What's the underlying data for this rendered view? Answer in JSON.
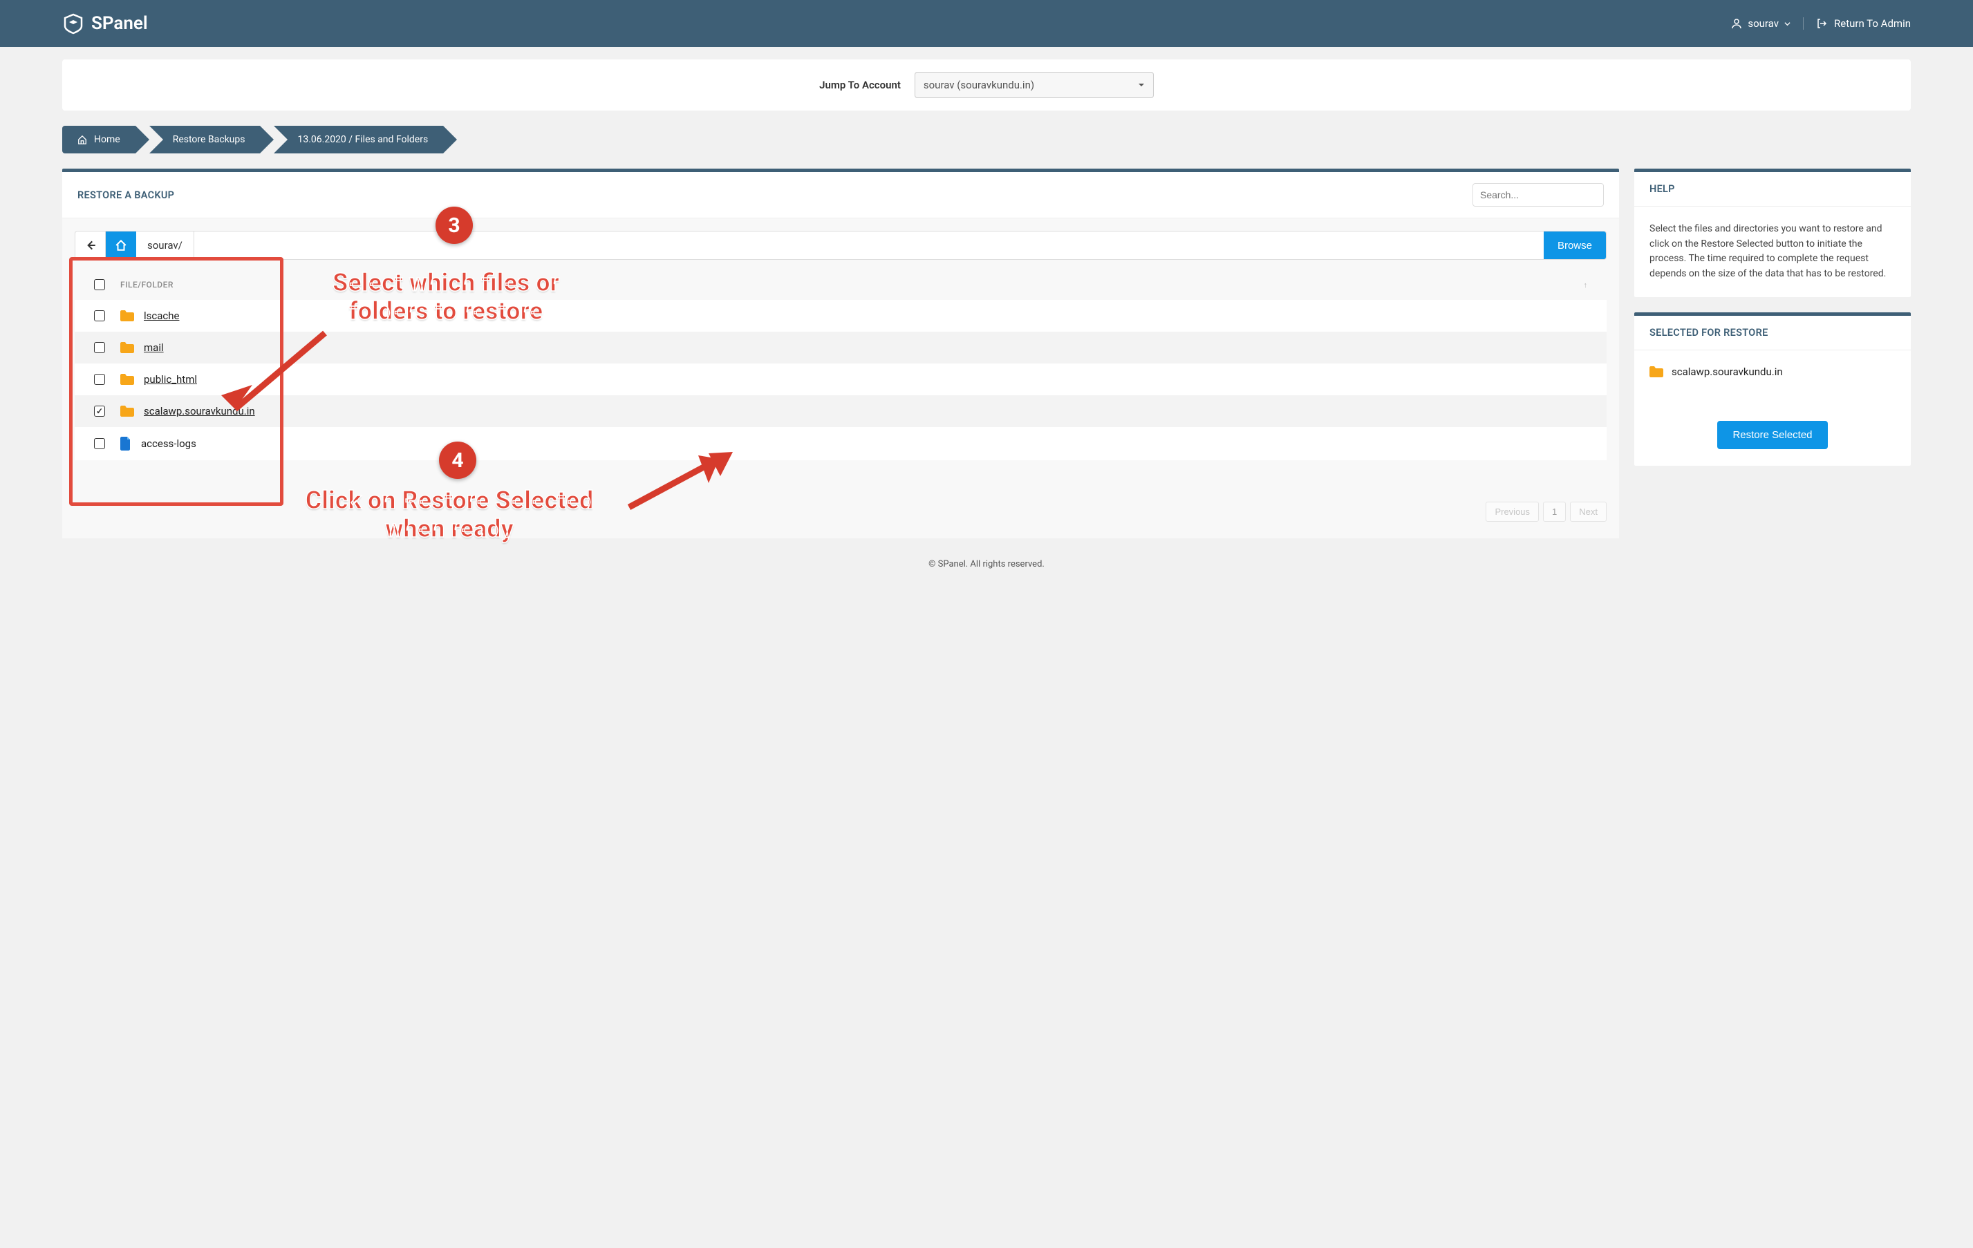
{
  "header": {
    "brand": "SPanel",
    "user": "sourav",
    "return_admin": "Return To Admin"
  },
  "jump": {
    "label": "Jump To Account",
    "selected": "sourav (souravkundu.in)"
  },
  "breadcrumb": {
    "home": "Home",
    "restore": "Restore Backups",
    "current": "13.06.2020 / Files and Folders"
  },
  "main": {
    "title": "RESTORE A BACKUP",
    "search_placeholder": "Search...",
    "path_segment": "sourav/",
    "browse": "Browse",
    "col_header": "FILE/FOLDER",
    "rows": [
      {
        "name": "lscache",
        "type": "folder",
        "checked": false
      },
      {
        "name": "mail",
        "type": "folder",
        "checked": false
      },
      {
        "name": "public_html",
        "type": "folder",
        "checked": false
      },
      {
        "name": "scalawp.souravkundu.in",
        "type": "folder",
        "checked": true
      },
      {
        "name": "access-logs",
        "type": "file",
        "checked": false
      }
    ]
  },
  "help": {
    "title": "HELP",
    "body": "Select the files and directories you want to restore and click on the Restore Selected button to initiate the process. The time required to complete the request depends on the size of the data that has to be restored."
  },
  "selected": {
    "title": "SELECTED FOR RESTORE",
    "item": "scalawp.souravkundu.in",
    "button": "Restore Selected"
  },
  "annotations": {
    "badge3": "3",
    "badge4": "4",
    "text3": "Select which files or folders to restore",
    "text4": "Click on Restore Selected when ready"
  },
  "pagination": {
    "prev": "Previous",
    "page": "1",
    "next": "Next"
  },
  "footer": "© SPanel. All rights reserved."
}
